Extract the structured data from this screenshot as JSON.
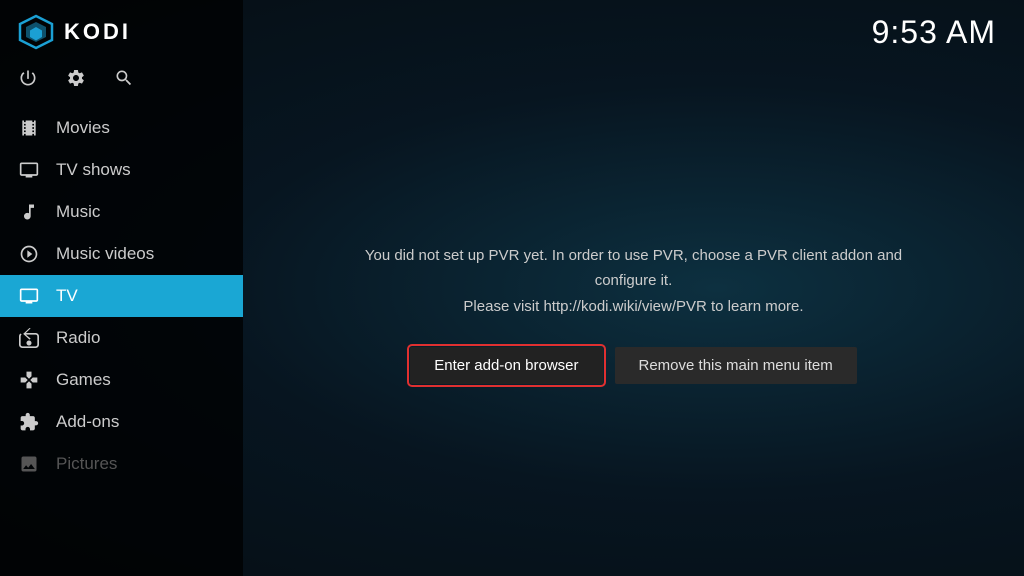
{
  "app": {
    "name": "KODI",
    "time": "9:53 AM"
  },
  "top_icons": {
    "power": "⏻",
    "settings": "⚙",
    "search": "🔍"
  },
  "nav": {
    "items": [
      {
        "id": "movies",
        "label": "Movies",
        "icon": "movies",
        "active": false,
        "disabled": false
      },
      {
        "id": "tvshows",
        "label": "TV shows",
        "icon": "tvshows",
        "active": false,
        "disabled": false
      },
      {
        "id": "music",
        "label": "Music",
        "icon": "music",
        "active": false,
        "disabled": false
      },
      {
        "id": "musicvideos",
        "label": "Music videos",
        "icon": "musicvideos",
        "active": false,
        "disabled": false
      },
      {
        "id": "tv",
        "label": "TV",
        "icon": "tv",
        "active": true,
        "disabled": false
      },
      {
        "id": "radio",
        "label": "Radio",
        "icon": "radio",
        "active": false,
        "disabled": false
      },
      {
        "id": "games",
        "label": "Games",
        "icon": "games",
        "active": false,
        "disabled": false
      },
      {
        "id": "addons",
        "label": "Add-ons",
        "icon": "addons",
        "active": false,
        "disabled": false
      },
      {
        "id": "pictures",
        "label": "Pictures",
        "icon": "pictures",
        "active": false,
        "disabled": true
      }
    ]
  },
  "pvr": {
    "message_line1": "You did not set up PVR yet. In order to use PVR, choose a PVR client addon and configure it.",
    "message_line2": "Please visit http://kodi.wiki/view/PVR to learn more.",
    "btn_addon": "Enter add-on browser",
    "btn_remove": "Remove this main menu item"
  }
}
